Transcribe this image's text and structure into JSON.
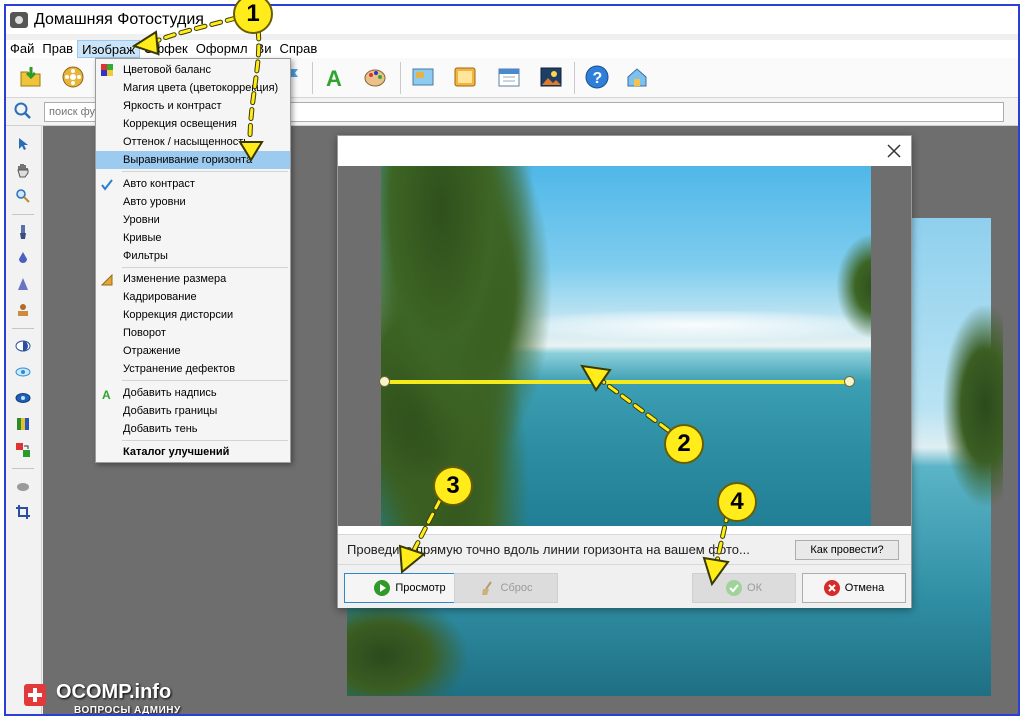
{
  "window": {
    "title": "Домашняя Фотостудия"
  },
  "menubar": {
    "items": [
      {
        "label": "Фай"
      },
      {
        "label": "Прав"
      },
      {
        "label": "Изображ"
      },
      {
        "label": "Эффек"
      },
      {
        "label": "Оформл"
      },
      {
        "label": "Ви"
      },
      {
        "label": "Справ"
      }
    ]
  },
  "search": {
    "placeholder": "поиск фу"
  },
  "image_menu": {
    "items": [
      {
        "label": "Цветовой баланс"
      },
      {
        "label": "Магия цвета (цветокоррекция)"
      },
      {
        "label": "Яркость и контраст"
      },
      {
        "label": "Коррекция освещения"
      },
      {
        "label": "Оттенок / насыщенность"
      },
      {
        "label": "Выравнивание горизонта"
      },
      {
        "label": "Авто контраст"
      },
      {
        "label": "Авто уровни"
      },
      {
        "label": "Уровни"
      },
      {
        "label": "Кривые"
      },
      {
        "label": "Фильтры"
      },
      {
        "label": "Изменение размера"
      },
      {
        "label": "Кадрирование"
      },
      {
        "label": "Коррекция дисторсии"
      },
      {
        "label": "Поворот"
      },
      {
        "label": "Отражение"
      },
      {
        "label": "Устранение дефектов"
      },
      {
        "label": "Добавить надпись"
      },
      {
        "label": "Добавить границы"
      },
      {
        "label": "Добавить тень"
      },
      {
        "label": "Каталог улучшений"
      }
    ]
  },
  "dialog": {
    "hint": "Проведите прямую точно вдоль линии горизонта на вашем фото...",
    "how_button": "Как провести?",
    "preview_button": "Просмотр",
    "reset_button": "Сброс",
    "ok_button": "ОК",
    "cancel_button": "Отмена"
  },
  "callouts": [
    "1",
    "2",
    "3",
    "4"
  ],
  "watermark": {
    "brand": "OCOMP.info",
    "subtitle": "ВОПРОСЫ АДМИНУ"
  },
  "colors": {
    "accent_yellow": "#ffec1a",
    "menu_highlight": "#9ccbef",
    "frame_border": "#2a3fd6",
    "horizon_line": "#f4ea1c"
  }
}
